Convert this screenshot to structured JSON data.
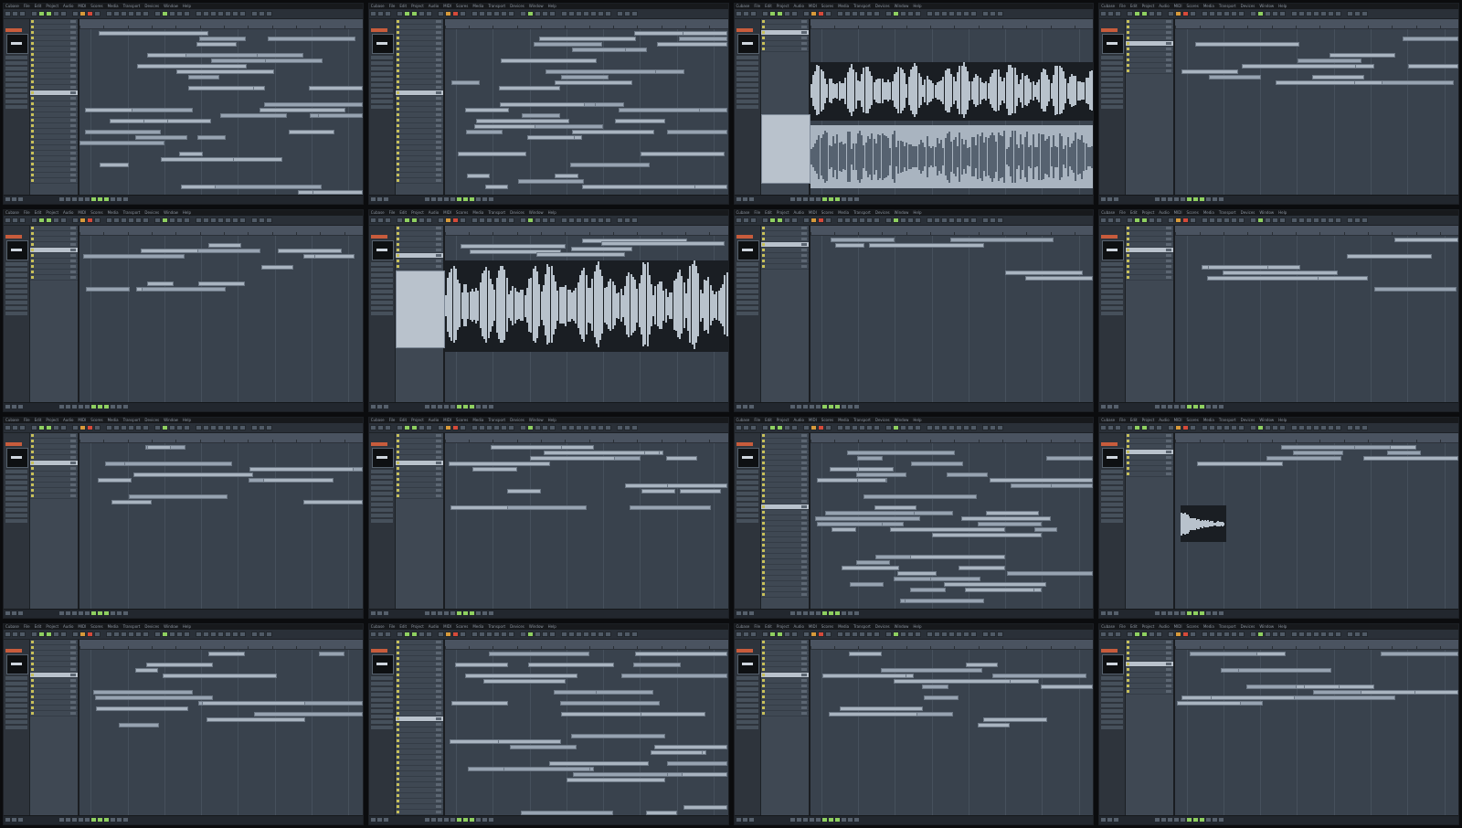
{
  "menu": [
    "Cubase",
    "File",
    "Edit",
    "Project",
    "Audio",
    "MIDI",
    "Scores",
    "Media",
    "Transport",
    "Devices",
    "Window",
    "Help"
  ],
  "project_title": "",
  "colors": {
    "panel_bg": "#3b4450",
    "clip": "#a9b4c0",
    "active_button": "#8fd060",
    "record_button": "#d64a3a",
    "track_icon": "#c8c05a"
  },
  "icons": [
    "play-icon",
    "stop-icon",
    "record-icon",
    "cycle-icon",
    "metronome-icon"
  ],
  "panels": [
    {
      "id": 1,
      "view": "arrange",
      "track_count": 30
    },
    {
      "id": 2,
      "view": "arrange",
      "track_count": 30
    },
    {
      "id": 3,
      "view": "waveform-editor",
      "track_count": 6
    },
    {
      "id": 4,
      "view": "arrange",
      "track_count": 10
    },
    {
      "id": 5,
      "view": "arrange",
      "track_count": 10
    },
    {
      "id": 6,
      "view": "waveform-editor",
      "track_count": 12
    },
    {
      "id": 7,
      "view": "arrange",
      "track_count": 8
    },
    {
      "id": 8,
      "view": "arrange",
      "track_count": 10
    },
    {
      "id": 9,
      "view": "arrange",
      "track_count": 12
    },
    {
      "id": 10,
      "view": "arrange",
      "track_count": 12
    },
    {
      "id": 11,
      "view": "arrange",
      "track_count": 30
    },
    {
      "id": 12,
      "view": "arrange",
      "track_count": 8
    },
    {
      "id": 13,
      "view": "arrange",
      "track_count": 14
    },
    {
      "id": 14,
      "view": "arrange",
      "track_count": 32
    },
    {
      "id": 15,
      "view": "arrange",
      "track_count": 14
    },
    {
      "id": 16,
      "view": "arrange",
      "track_count": 10
    }
  ]
}
